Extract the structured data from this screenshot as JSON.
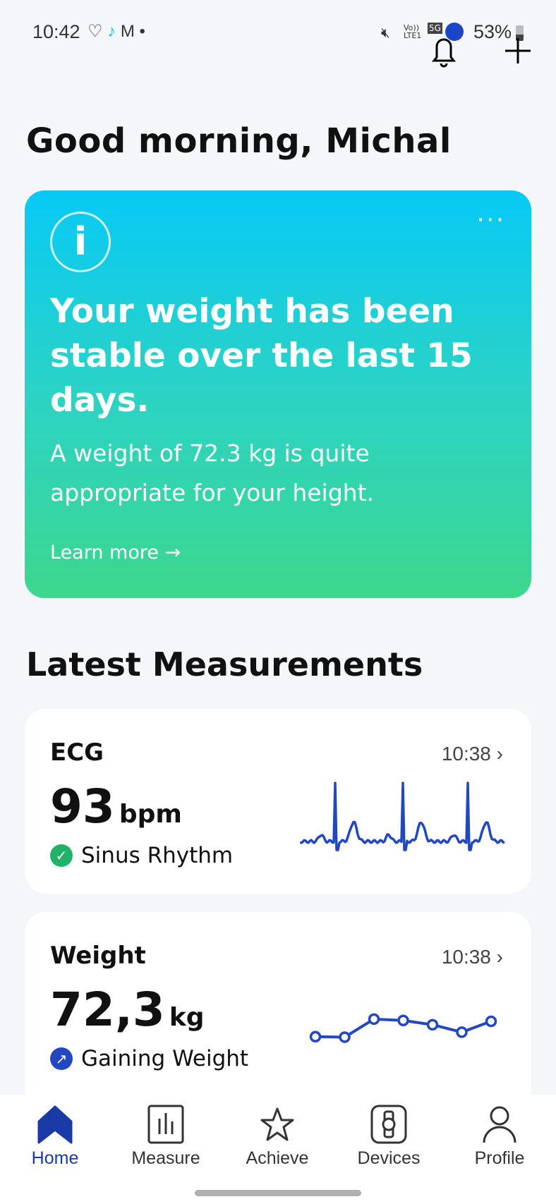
{
  "status_bar": {
    "time": "10:42",
    "battery": "53%",
    "network": "5G",
    "volte": "Vo)) LTE1"
  },
  "header": {
    "greeting": "Good morning, Michal"
  },
  "insight_card": {
    "icon": "info-icon",
    "headline": "Your weight has been stable over the last 15 days.",
    "body": "A weight of 72.3 kg is quite appropriate for your height.",
    "link": "Learn more →",
    "more": "···"
  },
  "section_title": "Latest Measurements",
  "measurements": [
    {
      "title": "ECG",
      "time": "10:38",
      "value": "93",
      "unit": "bpm",
      "status": "Sinus Rhythm",
      "status_icon": "check-circle-icon",
      "status_color": "#1fb36a"
    },
    {
      "title": "Weight",
      "time": "10:38",
      "value": "72,3",
      "unit": "kg",
      "status": "Gaining Weight",
      "status_icon": "arrow-up-right-icon",
      "status_color": "#2148c0",
      "trend": [
        0.1,
        0.08,
        0.88,
        0.82,
        0.63,
        0.3,
        0.78
      ]
    }
  ],
  "nav": [
    {
      "label": "Home",
      "icon": "home-icon",
      "active": true
    },
    {
      "label": "Measure",
      "icon": "chart-icon"
    },
    {
      "label": "Achieve",
      "icon": "star-icon"
    },
    {
      "label": "Devices",
      "icon": "watch-icon"
    },
    {
      "label": "Profile",
      "icon": "person-icon"
    }
  ],
  "colors": {
    "accent": "#2148c0",
    "active_nav": "#1a3aa8"
  }
}
